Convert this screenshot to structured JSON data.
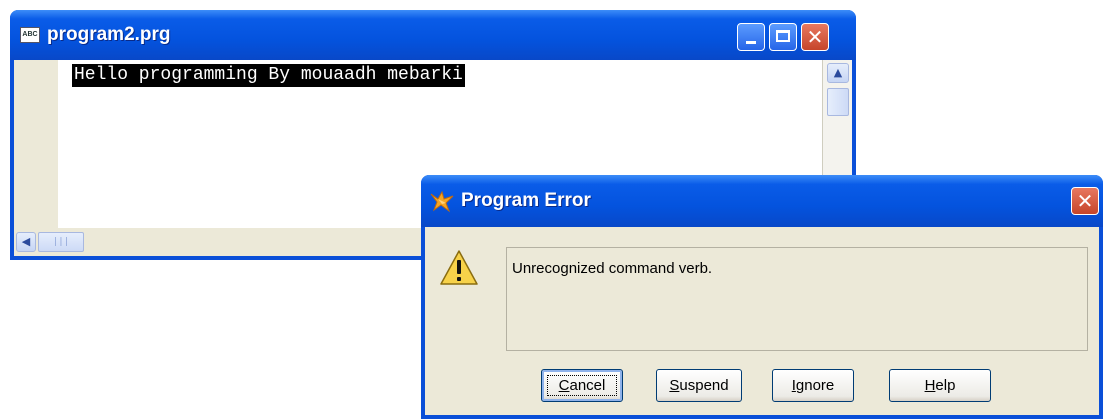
{
  "editor_window": {
    "title": "program2.prg",
    "icon": "abc-text-icon",
    "icon_text": "ABC",
    "code_line": "Hello programming By mouaadh mebarki",
    "controls": [
      "minimize-icon",
      "maximize-icon",
      "close-icon"
    ],
    "scroll_up_glyph": "▲",
    "scroll_left_glyph": "◀",
    "scroll_thumb_grip": "|||"
  },
  "dialog": {
    "title": "Program Error",
    "icon": "foxpro-icon",
    "close_glyph": "✕",
    "warning_icon": "warning-icon",
    "message": "Unrecognized command verb.",
    "buttons": {
      "cancel": {
        "access": "C",
        "rest": "ancel"
      },
      "suspend": {
        "access": "S",
        "rest": "uspend"
      },
      "ignore": {
        "access": "I",
        "rest": "gnore"
      },
      "help": {
        "access": "H",
        "rest": "elp"
      }
    }
  },
  "colors": {
    "titlebar_blue": "#0453de",
    "dialog_face": "#ece9d8",
    "close_red": "#c6452a"
  }
}
